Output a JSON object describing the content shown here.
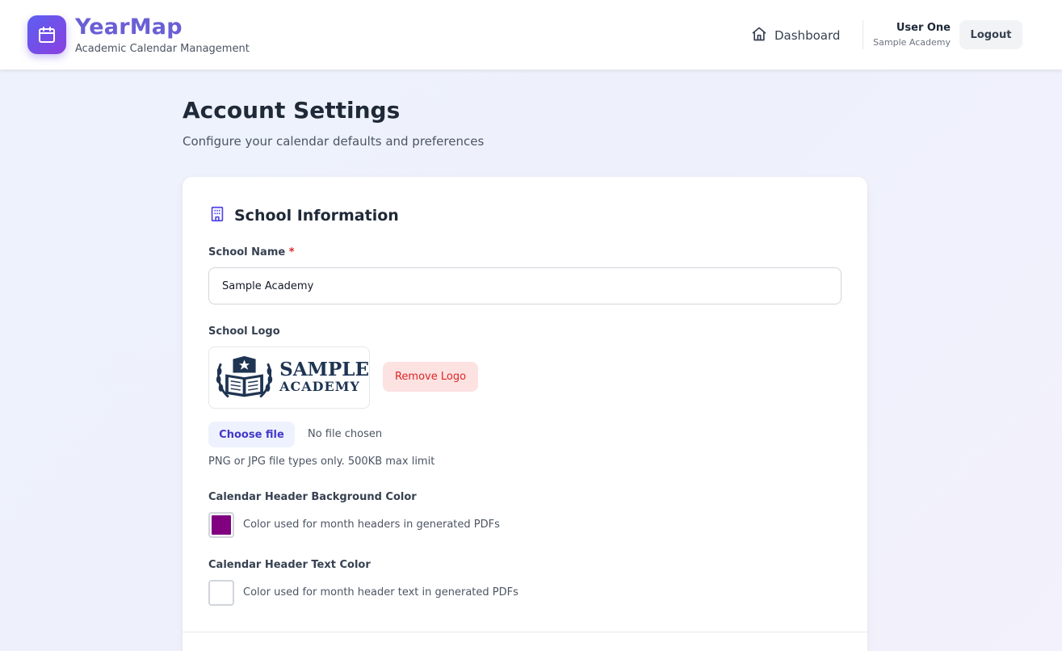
{
  "header": {
    "app_name": "YearMap",
    "tagline": "Academic Calendar Management",
    "nav_dashboard": "Dashboard",
    "user_name": "User One",
    "user_school": "Sample Academy",
    "logout_label": "Logout"
  },
  "page": {
    "title": "Account Settings",
    "subtitle": "Configure your calendar defaults and preferences"
  },
  "school_info": {
    "section_title": "School Information",
    "school_name_label": "School Name",
    "required_marker": "*",
    "school_name_value": "Sample Academy",
    "logo_label": "School Logo",
    "logo_line1": "SAMPLE",
    "logo_line2": "ACADEMY",
    "remove_logo_label": "Remove Logo",
    "choose_file_label": "Choose file",
    "no_file_text": "No file chosen",
    "file_help": "PNG or JPG file types only. 500KB max limit",
    "header_bg_label": "Calendar Header Background Color",
    "header_bg_desc": "Color used for month headers in generated PDFs",
    "header_bg_color": "#800080",
    "header_text_label": "Calendar Header Text Color",
    "header_text_desc": "Color used for month header text in generated PDFs",
    "header_text_color": "#ffffff"
  },
  "colors": {
    "brand_gradient_start": "#5b5ff0",
    "brand_gradient_end": "#8b3fe0",
    "accent": "#4338ca",
    "danger": "#dc2626"
  }
}
